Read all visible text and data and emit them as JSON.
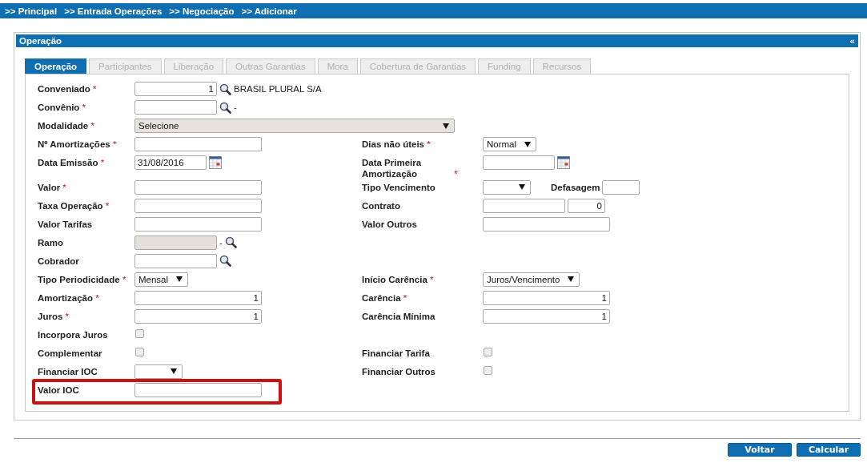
{
  "breadcrumb": [
    {
      "text": ">> Principal"
    },
    {
      "text": ">> Entrada Operações"
    },
    {
      "text": ">> Negociação"
    },
    {
      "text": ">> Adicionar"
    }
  ],
  "panel": {
    "title": "Operação",
    "collapse": "«"
  },
  "tabs": [
    {
      "label": "Operação",
      "selected": true,
      "disabled": false
    },
    {
      "label": "Participantes",
      "selected": false,
      "disabled": true
    },
    {
      "label": "Liberação",
      "selected": false,
      "disabled": true
    },
    {
      "label": "Outras Garantias",
      "selected": false,
      "disabled": true
    },
    {
      "label": "Mora",
      "selected": false,
      "disabled": true
    },
    {
      "label": "Cobertura de Garantias",
      "selected": false,
      "disabled": true
    },
    {
      "label": "Funding",
      "selected": false,
      "disabled": true
    },
    {
      "label": "Recursos",
      "selected": false,
      "disabled": true
    }
  ],
  "form_rows": [
    {
      "left": {
        "label": "Conveniado",
        "required_mark": "*",
        "fields": [
          {
            "kind": "short-input",
            "value": "1",
            "right_aligned": true
          },
          {
            "kind": "search"
          },
          {
            "kind": "text",
            "text": "BRASIL PLURAL S/A"
          }
        ]
      }
    },
    {
      "left": {
        "label": "Convênio",
        "required_mark": "*",
        "fields": [
          {
            "kind": "short-input"
          },
          {
            "kind": "search"
          },
          {
            "kind": "text",
            "text": "-"
          }
        ]
      }
    },
    {
      "left": {
        "label": "Modalidade",
        "required_mark": "*",
        "fields": [
          {
            "kind": "wide-select",
            "value": "Selecione"
          }
        ]
      }
    },
    {
      "left": {
        "label": "Nº Amortizações",
        "required_mark": "*",
        "fields": [
          {
            "kind": "input"
          }
        ]
      },
      "right": {
        "label": "Dias não úteis",
        "required_mark": "*",
        "fields": [
          {
            "kind": "select",
            "value": "Normal"
          }
        ]
      }
    },
    {
      "left": {
        "label": "Data Emissão",
        "required_mark": "*",
        "fields": [
          {
            "kind": "date",
            "value": "31/08/2016"
          }
        ]
      },
      "right": {
        "label": "Data Primeira Amortização",
        "required_mark": "*",
        "fields": [
          {
            "kind": "date"
          }
        ]
      }
    },
    {
      "left": {
        "label": "Valor",
        "required_mark": "*",
        "fields": [
          {
            "kind": "input"
          }
        ]
      },
      "right": {
        "label": "Tipo Vencimento",
        "fields": [
          {
            "kind": "select"
          },
          {
            "kind": "inline-label",
            "text": "Defasagem"
          },
          {
            "kind": "tiny-input"
          }
        ]
      }
    },
    {
      "left": {
        "label": "Taxa Operação",
        "required_mark": "*",
        "fields": [
          {
            "kind": "input"
          }
        ]
      },
      "right": {
        "label": "Contrato",
        "fields": [
          {
            "kind": "short-input"
          },
          {
            "kind": "tiny-input",
            "value": "0",
            "right_aligned": true
          }
        ]
      }
    },
    {
      "left": {
        "label": "Valor Tarifas",
        "fields": [
          {
            "kind": "input"
          }
        ]
      },
      "right": {
        "label": "Valor Outros",
        "fields": [
          {
            "kind": "input"
          }
        ]
      }
    },
    {
      "left": {
        "label": "Ramo",
        "fields": [
          {
            "kind": "short-input",
            "disabled": true
          },
          {
            "kind": "text",
            "text": "-"
          },
          {
            "kind": "search"
          }
        ]
      }
    },
    {
      "left": {
        "label": "Cobrador",
        "fields": [
          {
            "kind": "short-input"
          },
          {
            "kind": "search"
          }
        ]
      }
    },
    {
      "left": {
        "label": "Tipo Periodicidade",
        "required_mark": "*",
        "fields": [
          {
            "kind": "select",
            "value": "Mensal"
          }
        ]
      },
      "right": {
        "label": "Início Carência",
        "required_mark": "*",
        "fields": [
          {
            "kind": "select",
            "value": "Juros/Vencimento"
          }
        ]
      }
    },
    {
      "left": {
        "label": "Amortização",
        "required_mark": "*",
        "fields": [
          {
            "kind": "input",
            "value": "1",
            "right_aligned": true
          }
        ]
      },
      "right": {
        "label": "Carência",
        "required_mark": "*",
        "fields": [
          {
            "kind": "input",
            "value": "1",
            "right_aligned": true
          }
        ]
      }
    },
    {
      "left": {
        "label": "Juros",
        "required_mark": "*",
        "fields": [
          {
            "kind": "input",
            "value": "1",
            "right_aligned": true
          }
        ]
      },
      "right": {
        "label": "Carência Mínima",
        "fields": [
          {
            "kind": "input",
            "value": "1",
            "right_aligned": true
          }
        ]
      }
    },
    {
      "left": {
        "label": "Incorpora Juros",
        "fields": [
          {
            "kind": "checkbox",
            "checked": false
          }
        ]
      }
    },
    {
      "left": {
        "label": "Complementar",
        "fields": [
          {
            "kind": "checkbox",
            "checked": false
          }
        ]
      },
      "right": {
        "label": "Financiar Tarifa",
        "fields": [
          {
            "kind": "checkbox",
            "checked": false
          }
        ]
      }
    },
    {
      "left": {
        "label": "Financiar IOC",
        "fields": [
          {
            "kind": "select"
          }
        ]
      },
      "right": {
        "label": "Financiar Outros",
        "fields": [
          {
            "kind": "checkbox",
            "checked": false
          }
        ]
      }
    },
    {
      "highlighted": true,
      "left": {
        "label": "Valor IOC",
        "fields": [
          {
            "kind": "input"
          }
        ]
      }
    }
  ],
  "buttons": [
    {
      "label": "Voltar"
    },
    {
      "label": "Calcular"
    }
  ]
}
